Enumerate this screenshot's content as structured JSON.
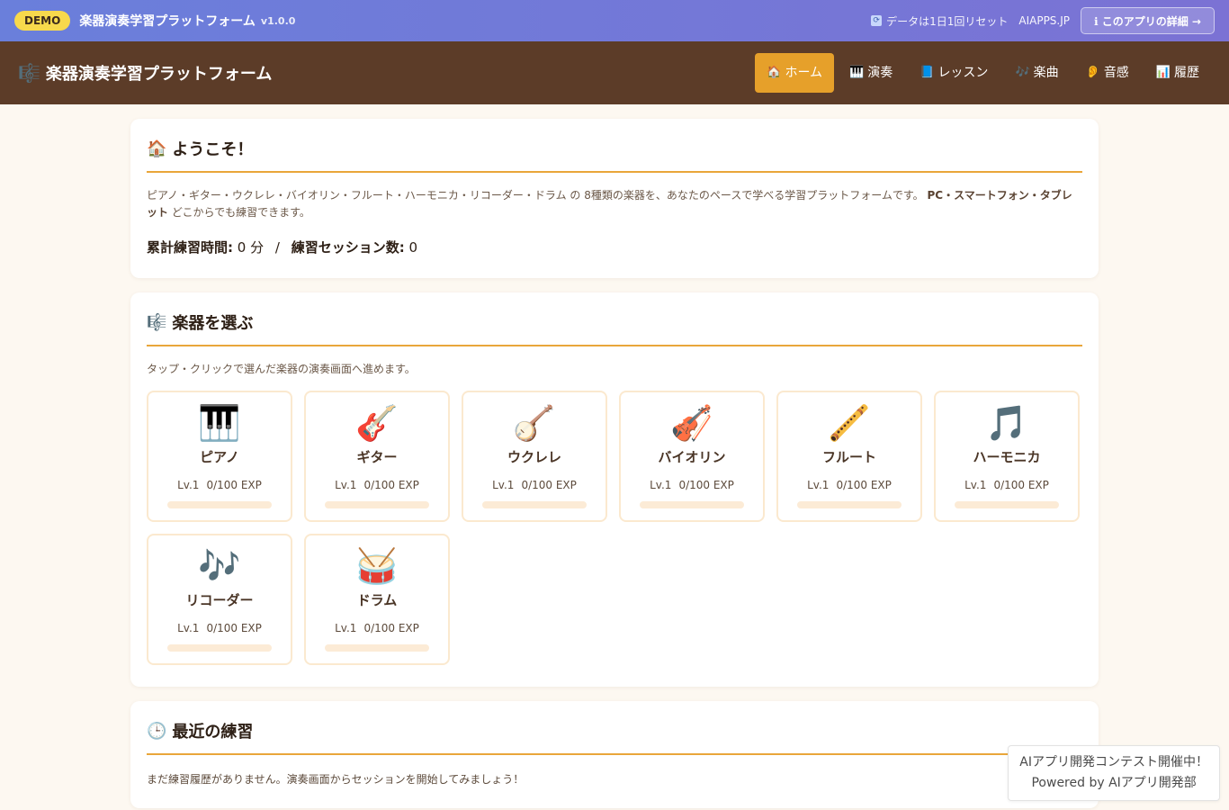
{
  "demo_bar": {
    "badge": "DEMO",
    "title": "楽器演奏学習プラットフォーム",
    "version": "v1.0.0",
    "reset_icon": "refresh-icon",
    "reset_text": "データは1日1回リセット",
    "site": "AIAPPS.JP",
    "detail_button": "ℹ このアプリの詳細 →"
  },
  "header": {
    "brand_icon": "🎼",
    "brand": "楽器演奏学習プラットフォーム",
    "nav": [
      {
        "icon": "🏠",
        "label": "ホーム",
        "active": true
      },
      {
        "icon": "🎹",
        "label": "演奏"
      },
      {
        "icon": "📘",
        "label": "レッスン"
      },
      {
        "icon": "🎶",
        "label": "楽曲"
      },
      {
        "icon": "👂",
        "label": "音感"
      },
      {
        "icon": "📊",
        "label": "履歴"
      }
    ]
  },
  "welcome": {
    "icon": "🏠",
    "title": "ようこそ！",
    "desc_part1": "ピアノ・ギター・ウクレレ・バイオリン・フルート・ハーモニカ・リコーダー・ドラム の 8種類の楽器を、あなたのペースで学べる学習プラットフォームです。",
    "desc_bold": "PC・スマートフォン・タブレット",
    "desc_part2": "どこからでも練習できます。",
    "total_label": "累計練習時間:",
    "total_value": "0 分",
    "separator": "/",
    "sessions_label": "練習セッション数:",
    "sessions_value": "0"
  },
  "instruments": {
    "icon": "🎼",
    "title": "楽器を選ぶ",
    "desc": "タップ・クリックで選んだ楽器の演奏画面へ進めます。",
    "items": [
      {
        "icon": "piano-icon",
        "emoji": "🎹",
        "name": "ピアノ",
        "level": "Lv.1",
        "exp": "0/100 EXP",
        "progress": 0
      },
      {
        "icon": "guitar-icon",
        "emoji": "🎸",
        "name": "ギター",
        "level": "Lv.1",
        "exp": "0/100 EXP",
        "progress": 0
      },
      {
        "icon": "banjo-icon",
        "emoji": "🪕",
        "name": "ウクレレ",
        "level": "Lv.1",
        "exp": "0/100 EXP",
        "progress": 0
      },
      {
        "icon": "violin-icon",
        "emoji": "🎻",
        "name": "バイオリン",
        "level": "Lv.1",
        "exp": "0/100 EXP",
        "progress": 0
      },
      {
        "icon": "flute-icon",
        "emoji": "🪈",
        "name": "フルート",
        "level": "Lv.1",
        "exp": "0/100 EXP",
        "progress": 0
      },
      {
        "icon": "music-note-icon",
        "emoji": "🎵",
        "name": "ハーモニカ",
        "level": "Lv.1",
        "exp": "0/100 EXP",
        "progress": 0
      },
      {
        "icon": "music-notes-icon",
        "emoji": "🎶",
        "name": "リコーダー",
        "level": "Lv.1",
        "exp": "0/100 EXP",
        "progress": 0
      },
      {
        "icon": "drum-icon",
        "emoji": "🥁",
        "name": "ドラム",
        "level": "Lv.1",
        "exp": "0/100 EXP",
        "progress": 0
      }
    ]
  },
  "recent": {
    "icon": "🕒",
    "title": "最近の練習",
    "empty": "まだ練習履歴がありません。演奏画面からセッションを開始してみましょう！"
  },
  "contest": {
    "line1": "AIアプリ開発コンテスト開催中！",
    "line2": "Powered by AIアプリ開発部"
  },
  "colors": {
    "accent": "#e6a02a",
    "header_bg": "#5c3c28",
    "demo_bar": "#6a7fdb"
  }
}
